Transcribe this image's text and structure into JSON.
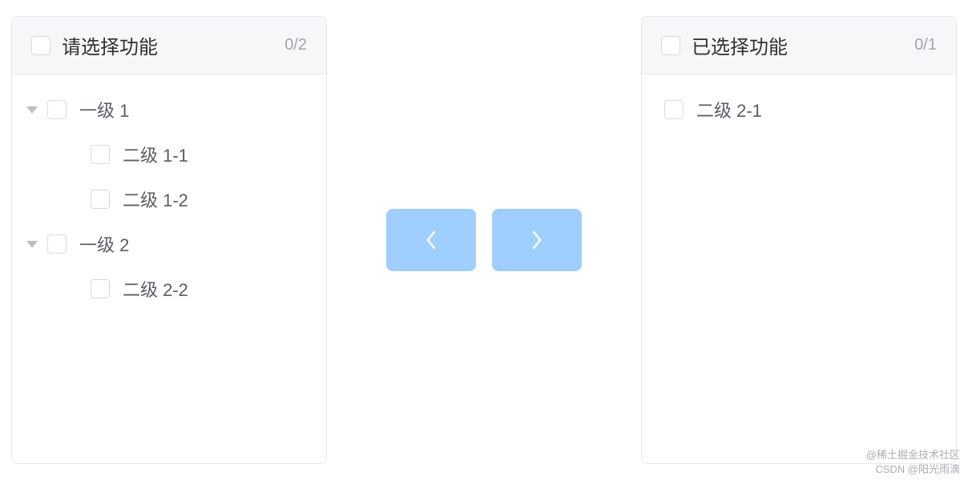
{
  "left_panel": {
    "title": "请选择功能",
    "count": "0/2",
    "tree": [
      {
        "level": 1,
        "expandable": true,
        "label": "一级 1"
      },
      {
        "level": 2,
        "expandable": false,
        "label": "二级 1-1"
      },
      {
        "level": 2,
        "expandable": false,
        "label": "二级 1-2"
      },
      {
        "level": 1,
        "expandable": true,
        "label": "一级 2"
      },
      {
        "level": 2,
        "expandable": false,
        "label": "二级 2-2"
      }
    ]
  },
  "right_panel": {
    "title": "已选择功能",
    "count": "0/1",
    "items": [
      {
        "label": "二级 2-1"
      }
    ]
  },
  "watermark": {
    "line1": "@稀土掘金技术社区",
    "line2": "CSDN @阳光雨滴"
  }
}
